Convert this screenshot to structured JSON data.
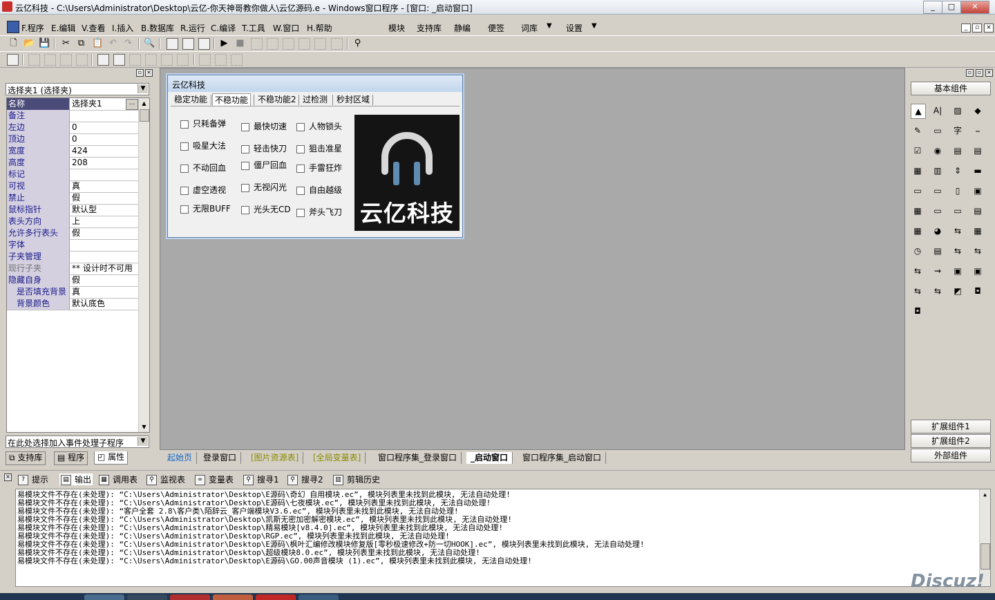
{
  "window": {
    "title": "云亿科技 - C:\\Users\\Administrator\\Desktop\\云亿-你天神哥教你做人\\云亿源码.e - Windows窗口程序 - [窗口: _启动窗口]",
    "min": "_",
    "max": "□",
    "close": "✕"
  },
  "menu": {
    "items": [
      "F.程序",
      "E.编辑",
      "V.查看",
      "I.插入",
      "B.数据库",
      "R.运行",
      "C.编译",
      "T.工具",
      "W.窗口",
      "H.帮助"
    ],
    "extras": [
      "模块",
      "支持库",
      "静编",
      "便签",
      "词库",
      "设置"
    ]
  },
  "left_panel": {
    "object_select": "选择夹1 (选择夹)",
    "event_select": "在此处选择加入事件处理子程序",
    "ellipsis": "...",
    "properties": [
      {
        "name": "名称",
        "value": "选择夹1"
      },
      {
        "name": "备注",
        "value": ""
      },
      {
        "name": "左边",
        "value": "0"
      },
      {
        "name": "顶边",
        "value": "0"
      },
      {
        "name": "宽度",
        "value": "424"
      },
      {
        "name": "高度",
        "value": "208"
      },
      {
        "name": "标记",
        "value": ""
      },
      {
        "name": "可视",
        "value": "真"
      },
      {
        "name": "禁止",
        "value": "假"
      },
      {
        "name": "鼠标指针",
        "value": "默认型"
      },
      {
        "name": "表头方向",
        "value": "上"
      },
      {
        "name": "允许多行表头",
        "value": "假"
      },
      {
        "name": "字体",
        "value": ""
      },
      {
        "name": "子夹管理",
        "value": ""
      },
      {
        "name": "现行子夹",
        "value": "** 设计时不可用"
      },
      {
        "name": "隐藏自身",
        "value": "假"
      },
      {
        "name": "是否填充背景",
        "value": "真"
      },
      {
        "name": "背景颜色",
        "value": "默认底色"
      }
    ],
    "bottom_tabs": [
      "支持库",
      "程序",
      "属性"
    ]
  },
  "form": {
    "title": "云亿科技",
    "tabs": [
      "稳定功能",
      "不稳功能",
      "不稳功能2",
      "过检测",
      "秒封区域"
    ],
    "checkboxes": [
      [
        "只耗备弹",
        "吸星大法",
        "不动回血",
        "虚空透视",
        "无限BUFF"
      ],
      [
        "最快切速",
        "轻击快刀",
        "僵尸回血",
        "无视闪光",
        "光头无CD"
      ],
      [
        "人物锁头",
        "狙击准星",
        "手雷狂炸",
        "自由越级",
        "斧头飞刀"
      ]
    ],
    "logo_text": "云亿科技"
  },
  "right_panel": {
    "basic": "基本组件",
    "ext1": "扩展组件1",
    "ext2": "扩展组件2",
    "external": "外部组件",
    "icons": [
      "▲",
      "A|",
      "▨",
      "◆",
      "✎",
      "▭",
      "字",
      "⎯",
      "☑",
      "◉",
      "▤",
      "▤",
      "▦",
      "▥",
      "⇕",
      "▬",
      "▭",
      "▭",
      "▯",
      "▣",
      "▦",
      "▭",
      "▭",
      "▤",
      "▦",
      "◕",
      "⇆",
      "▦",
      "◷",
      "▤",
      "⇆",
      "⇆",
      "⇆",
      "⇝",
      "▣",
      "▣",
      "⇆",
      "⇆",
      "◩",
      "◘",
      "◘"
    ]
  },
  "doc_tabs": [
    "起始页",
    "登录窗口",
    "[图片资源表]",
    "[全局变量表]",
    "窗口程序集_登录窗口",
    "_启动窗口",
    "窗口程序集_启动窗口"
  ],
  "output_tabs": [
    "提示",
    "输出",
    "调用表",
    "监视表",
    "变量表",
    "搜寻1",
    "搜寻2",
    "剪辑历史"
  ],
  "output_lines": [
    "易模块文件不存在(未处理): “C:\\Users\\Administrator\\Desktop\\E源码\\奇幻 自用模块.ec”, 模块列表里未找到此模块, 无法自动处理!",
    "易模块文件不存在(未处理): “C:\\Users\\Administrator\\Desktop\\E源码\\七夜模块.ec”, 模块列表里未找到此模块, 无法自动处理!",
    "易模块文件不存在(未处理): “客户全套 2.8\\客户类\\陌辞云_客户端模块V3.6.ec”, 模块列表里未找到此模块, 无法自动处理!",
    "易模块文件不存在(未处理): “C:\\Users\\Administrator\\Desktop\\凯斯无密加密解密模块.ec”, 模块列表里未找到此模块, 无法自动处理!",
    "易模块文件不存在(未处理): “C:\\Users\\Administrator\\Desktop\\精易模块[v8.4.0].ec”, 模块列表里未找到此模块, 无法自动处理!",
    "易模块文件不存在(未处理): “C:\\Users\\Administrator\\Desktop\\RGP.ec”, 模块列表里未找到此模块, 无法自动处理!",
    "易模块文件不存在(未处理): “C:\\Users\\Administrator\\Desktop\\E源码\\枫叶汇编修改模块修复版[零秒极速修改+防一切HOOK].ec”, 模块列表里未找到此模块, 无法自动处理!",
    "易模块文件不存在(未处理): “C:\\Users\\Administrator\\Desktop\\超级模块8.0.ec”, 模块列表里未找到此模块, 无法自动处理!",
    "易模块文件不存在(未处理): “C:\\Users\\Administrator\\Desktop\\E源码\\GO.00声音模块 (1).ec”, 模块列表里未找到此模块, 无法自动处理!"
  ],
  "watermark": "Discuz!"
}
